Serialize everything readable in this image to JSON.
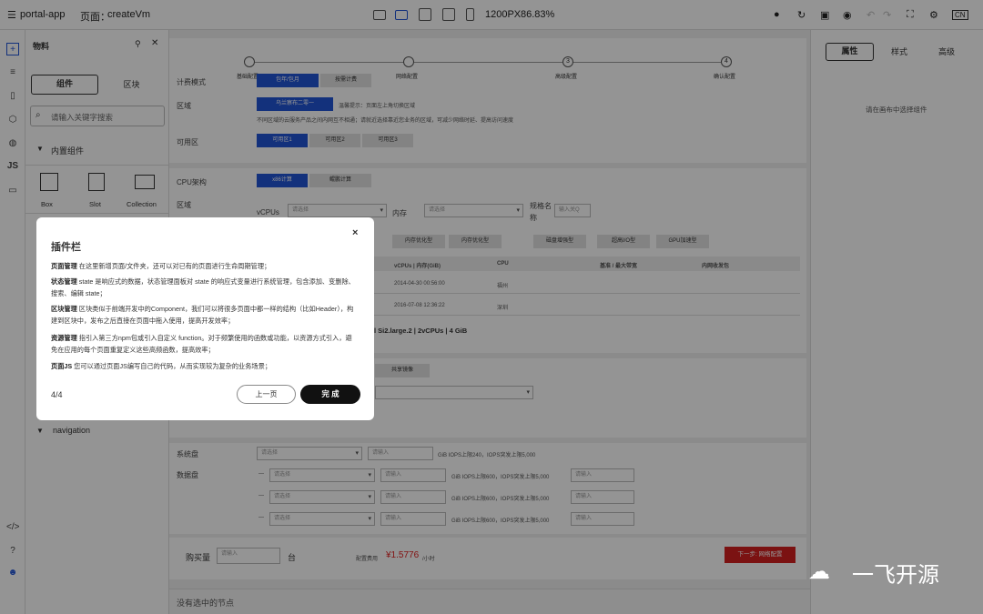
{
  "topbar": {
    "app": "portal-app",
    "page_label": "页面：",
    "page_name": "createVm",
    "width": "1200PX",
    "zoom": "86.83%",
    "lang": "CN"
  },
  "leftbar": {
    "js": "JS"
  },
  "panel": {
    "title": "物料",
    "tabs": [
      "组件",
      "区块"
    ],
    "search_placeholder": "请输入关键字搜索",
    "section": "内置组件",
    "items": [
      "Box",
      "Slot",
      "Collection"
    ],
    "section2": "navigation"
  },
  "steps": [
    "基础配置",
    "网络配置",
    "高级配置",
    "确认配置"
  ],
  "step_nums": [
    "",
    "",
    "3",
    "4"
  ],
  "form": {
    "billing_label": "计费模式",
    "billing": [
      "包年/包月",
      "按需计费"
    ],
    "region_label": "区域",
    "region_btn": "乌兰察布二零一",
    "region_tip": "温馨提示：页面左上角切换区域",
    "region_note": "不同区域的云服务产品之间内网互不相通；请就近选择靠近您业务的区域，可减少网络时延、提高访问速度",
    "az_label": "可用区",
    "az": [
      "可用区1",
      "可用区2",
      "可用区3"
    ],
    "cpu_label": "CPU架构",
    "cpu": [
      "x86计算",
      "鲲鹏计算"
    ],
    "region2_label": "区域",
    "vcpus_label": "vCPUs",
    "select_ph": "请选择",
    "mem_label": "内存",
    "spec_label": "规格名称",
    "spec_ph": "输入关Q",
    "types": [
      "内存优化型",
      "内存优化型",
      "磁盘增强型",
      "超高I/O型",
      "GPU加速型"
    ],
    "table_head": [
      "vCPUs | 内存(GiB)",
      "CPU",
      "基准 / 最大带宽",
      "内网收发包"
    ],
    "rows": [
      [
        "2014-04-30 00:56:00",
        "福州"
      ],
      [
        "2016-07-08 12:36:22",
        "深圳"
      ]
    ],
    "selected": "l Si2.large.2 | 2vCPUs | 4 GiB",
    "mirror": "共享镜像",
    "sysdisk_label": "系统盘",
    "input_ph": "请输入",
    "sysdisk_note": "GiB IOPS上限240，IOPS突发上限5,000",
    "datadisk_label": "数据盘",
    "datadisk_note": "GiB IOPS上限600，IOPS突发上限5,000",
    "qty_label": "购买量",
    "qty_unit": "台",
    "fee_label": "配置费用",
    "fee": "¥1.5776",
    "fee_unit": "/小时",
    "next": "下一步: 网络配置"
  },
  "status": "没有选中的节点",
  "right": {
    "tabs": [
      "属性",
      "样式",
      "高级"
    ],
    "hint": "请在画布中选择组件"
  },
  "modal": {
    "title": "插件栏",
    "items": [
      [
        "页面管理",
        "在这里新增页面/文件夹，还可以对已有的页面进行生命周期管理；"
      ],
      [
        "状态管理",
        "state 是响应式的数据，状态管理面板对 state 的响应式变量进行系统管理，包含添加、变删除、搜索、编辑 state；"
      ],
      [
        "区块管理",
        "区块类似于前端开发中的Component，我们可以将很多页面中都一样的结构（比如Header），构建到区块中，发布之后直接在页面中拖入使用，提高开发效率；"
      ],
      [
        "资源管理",
        "指引入第三方npm包或引入自定义 function。对于频繁使用的函数或功能，以资源方式引入，避免在应用的每个页面重复定义这些高频函数，提高效率；"
      ],
      [
        "页面JS",
        "您可以通过页面JS编写自己的代码，从而实现较为复杂的业务场景；"
      ]
    ],
    "page": "4/4",
    "prev": "上一页",
    "done": "完 成"
  },
  "watermark": "一飞开源"
}
